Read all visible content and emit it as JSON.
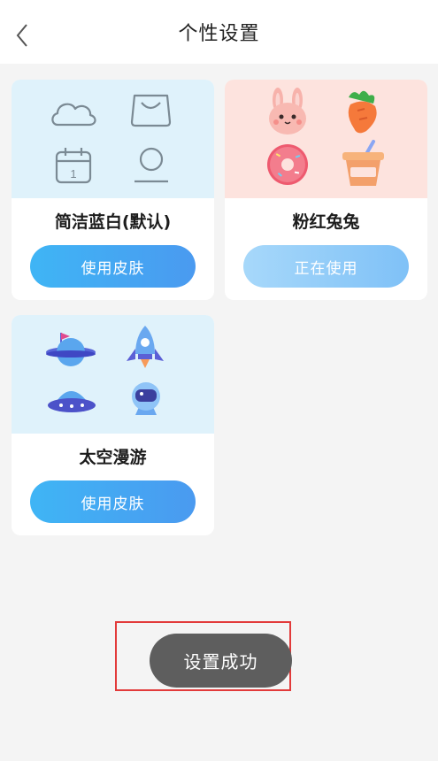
{
  "header": {
    "title": "个性设置",
    "back_icon": "chevron-left-icon"
  },
  "themes": [
    {
      "name": "简洁蓝白(默认)",
      "button_label": "使用皮肤",
      "state": "available",
      "preview_bg": "#dff2fb",
      "icons": [
        "cloud-icon",
        "bag-icon",
        "calendar-icon",
        "profile-icon"
      ],
      "calendar_day": "1"
    },
    {
      "name": "粉红兔兔",
      "button_label": "正在使用",
      "state": "in-use",
      "preview_bg": "#fde3de",
      "icons": [
        "rabbit-icon",
        "carrot-icon",
        "donut-icon",
        "drink-cup-icon"
      ]
    },
    {
      "name": "太空漫游",
      "button_label": "使用皮肤",
      "state": "available",
      "preview_bg": "#dff2fb",
      "icons": [
        "planet-flag-icon",
        "rocket-icon",
        "ufo-icon",
        "astronaut-icon"
      ]
    }
  ],
  "toast": {
    "message": "设置成功"
  },
  "colors": {
    "accent": "#4a9af0",
    "toast_bg": "#5e5e5e",
    "highlight_border": "#e23a3a",
    "page_bg": "#f4f4f4"
  }
}
